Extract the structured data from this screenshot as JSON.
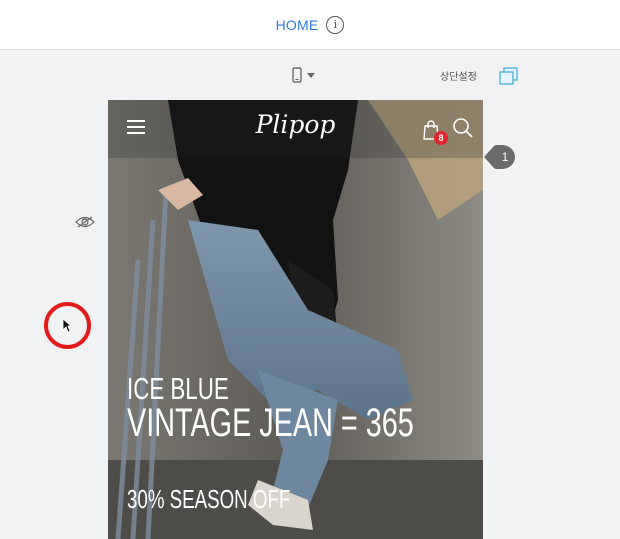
{
  "header": {
    "title": "HOME",
    "info_icon": "info-icon"
  },
  "toolbar": {
    "device_icon": "mobile-phone-icon",
    "top_settings_label": "상단설정",
    "copy_icon": "copy-icon"
  },
  "preview": {
    "logo": "Plipop",
    "cart_count": "8",
    "headline_line1": "ICE BLUE",
    "headline_line2": "VINTAGE JEAN = 365",
    "headline_line3": "30% SEASON OFF"
  },
  "side": {
    "marker_label": "1"
  },
  "colors": {
    "accent": "#2f7be0",
    "badge": "#e0262e",
    "highlight": "#e11b1b",
    "copy_icon": "#3fa9d8"
  }
}
